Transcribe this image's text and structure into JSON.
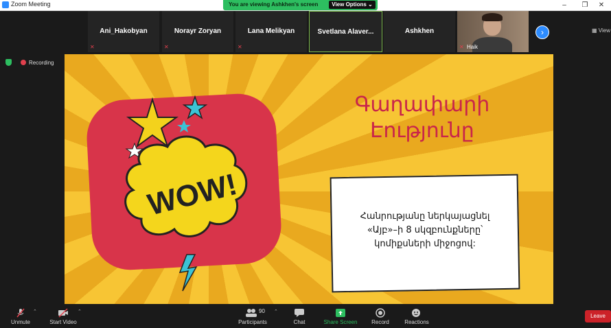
{
  "window": {
    "title": "Zoom Meeting",
    "controls": [
      "–",
      "❐",
      "✕"
    ]
  },
  "share_banner": {
    "message": "You are viewing Ashkhen's screen",
    "view_options": "View Options ⌄"
  },
  "participants_strip": {
    "tiles": [
      {
        "name": "Ani_Hakobyan",
        "muted": true
      },
      {
        "name": "Norayr Zoryan",
        "muted": true
      },
      {
        "name": "Lana Melikyan",
        "muted": true
      },
      {
        "name": "Svetlana  Alaver...",
        "muted": false,
        "active": true
      },
      {
        "name": "Ashkhen",
        "muted": false
      },
      {
        "name": "Haik",
        "muted": true,
        "video": true
      }
    ],
    "next_icon": "chevron-right-icon",
    "view_label": "View"
  },
  "status": {
    "recording_label": "Recording"
  },
  "slide": {
    "title_line1": "Գաղափարի",
    "title_line2": "Էությունը",
    "wow_text": "WOW!",
    "callout_line1": "Հանրությանը ներկայացնել",
    "callout_line2": "«Այբ»–ի 8 սկզբունքները՝",
    "callout_line3": "կոմիքսների միջոցով:"
  },
  "toolbar": {
    "unmute": "Unmute",
    "start_video": "Start Video",
    "participants": "Participants",
    "participants_count": "90",
    "chat": "Chat",
    "share_screen": "Share Screen",
    "record": "Record",
    "reactions": "Reactions",
    "leave": "Leave"
  },
  "colors": {
    "accent": "#2d8cff",
    "share_green": "#2dbe60",
    "leave_red": "#cc2229",
    "slide_title": "#c9254a"
  }
}
